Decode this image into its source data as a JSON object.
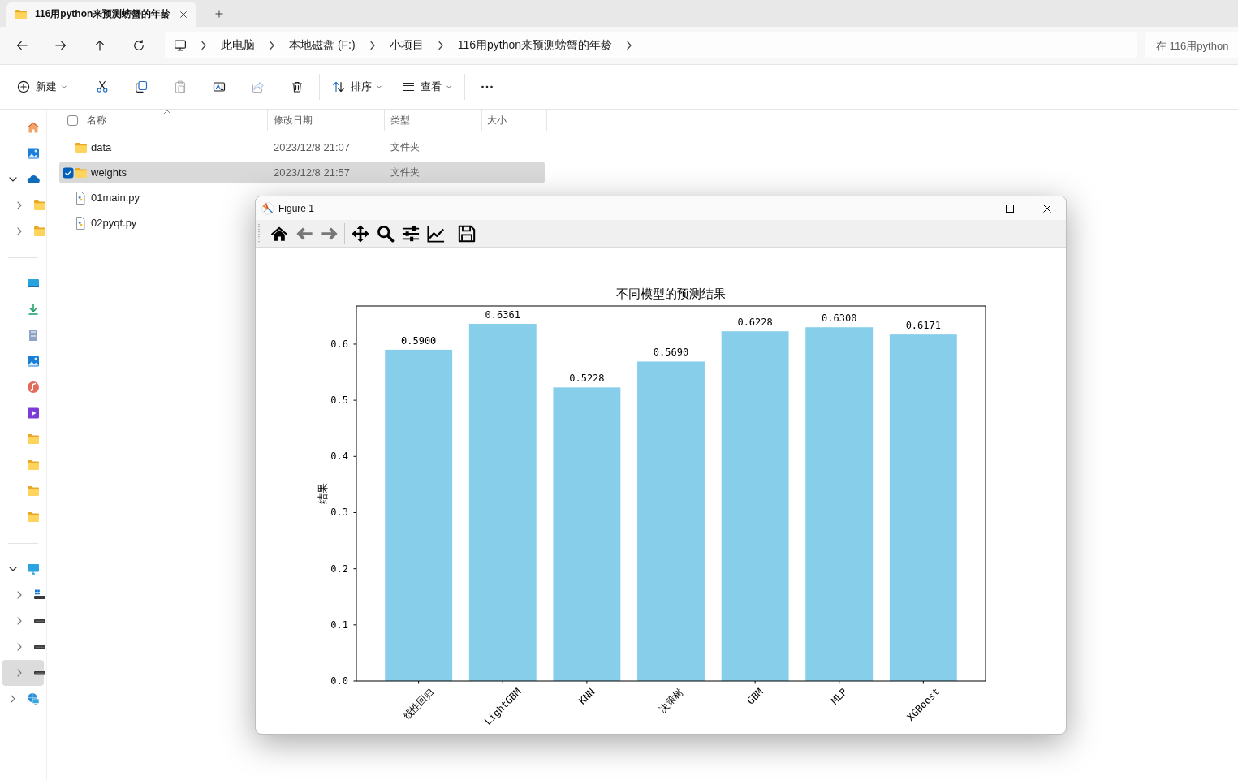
{
  "tabs": [
    {
      "title": "116用python来预测螃蟹的年龄",
      "selected": true
    }
  ],
  "nav_buttons": [
    {
      "kind": "back",
      "disabled": false
    },
    {
      "kind": "forward",
      "disabled": false
    },
    {
      "kind": "up",
      "disabled": false
    },
    {
      "kind": "refresh",
      "disabled": false
    }
  ],
  "address_bar": {
    "segments": [
      "此电脑",
      "本地磁盘 (F:)",
      "小项目",
      "116用python来预测螃蟹的年龄"
    ]
  },
  "search": {
    "placeholder": "在 116用python"
  },
  "toolbar": {
    "groups": [
      [
        {
          "kind": "new",
          "label": "新建",
          "menu": true,
          "disabled": false
        }
      ],
      [
        {
          "kind": "cut",
          "menu": false,
          "disabled": false
        },
        {
          "kind": "copy",
          "menu": false,
          "disabled": false
        },
        {
          "kind": "paste",
          "menu": false,
          "disabled": true
        },
        {
          "kind": "rename",
          "menu": false,
          "disabled": false
        },
        {
          "kind": "share",
          "menu": false,
          "disabled": true
        },
        {
          "kind": "delete",
          "menu": false,
          "disabled": false
        }
      ],
      [
        {
          "kind": "sort",
          "label": "排序",
          "menu": true,
          "disabled": false
        },
        {
          "kind": "view",
          "label": "查看",
          "menu": true,
          "disabled": false
        }
      ],
      [
        {
          "kind": "more",
          "menu": false,
          "disabled": false
        }
      ]
    ]
  },
  "nav_pane": {
    "sections": [
      {
        "items": [
          {
            "kind": "home",
            "selected": false
          },
          {
            "kind": "gallery",
            "selected": false
          },
          {
            "kind": "cloud",
            "expanded": true,
            "selected": false,
            "children": [
              {
                "kind": "folder",
                "expanded": false,
                "selected": false
              },
              {
                "kind": "folder",
                "expanded": false,
                "selected": false
              }
            ]
          }
        ]
      },
      {
        "items": [
          {
            "kind": "desktop",
            "selected": false
          },
          {
            "kind": "downloads",
            "selected": false
          },
          {
            "kind": "documents",
            "selected": false
          },
          {
            "kind": "pictures",
            "selected": false
          },
          {
            "kind": "music",
            "selected": false
          },
          {
            "kind": "videos",
            "selected": false
          },
          {
            "kind": "folder",
            "selected": false
          },
          {
            "kind": "folder",
            "selected": false
          },
          {
            "kind": "folder",
            "selected": false
          },
          {
            "kind": "folder",
            "selected": false
          }
        ]
      },
      {
        "items": [
          {
            "kind": "pc",
            "expanded": true,
            "selected": false,
            "children": [
              {
                "kind": "system-drive",
                "expanded": false,
                "selected": false
              },
              {
                "kind": "drive",
                "expanded": false,
                "selected": false
              },
              {
                "kind": "drive",
                "expanded": false,
                "selected": false
              },
              {
                "kind": "drive",
                "expanded": false,
                "selected": true
              }
            ]
          },
          {
            "kind": "network",
            "expanded": false,
            "selected": false
          }
        ]
      }
    ]
  },
  "file_list": {
    "select_all": {
      "checked": false
    },
    "columns": [
      {
        "label": "名称",
        "sorted": true
      },
      {
        "label": "修改日期",
        "sorted": false
      },
      {
        "label": "类型",
        "sorted": false
      },
      {
        "label": "大小",
        "sorted": false
      }
    ],
    "rows": [
      {
        "kind": "folder",
        "name": "data",
        "date": "2023/12/8 21:07",
        "type": "文件夹",
        "selected": false
      },
      {
        "kind": "folder",
        "name": "weights",
        "date": "2023/12/8 21:57",
        "type": "文件夹",
        "selected": true
      },
      {
        "kind": "python",
        "name": "01main.py",
        "selected": false
      },
      {
        "kind": "python",
        "name": "02pyqt.py",
        "selected": false
      }
    ]
  },
  "figure_window": {
    "title": "Figure 1",
    "toolbar": {
      "groups": [
        [
          {
            "kind": "home",
            "disabled": false
          },
          {
            "kind": "back",
            "disabled": true
          },
          {
            "kind": "forward",
            "disabled": true
          }
        ],
        [
          {
            "kind": "pan",
            "disabled": false
          },
          {
            "kind": "zoom",
            "disabled": false
          },
          {
            "kind": "subplots",
            "disabled": false
          },
          {
            "kind": "edit",
            "disabled": false
          }
        ],
        [
          {
            "kind": "save",
            "disabled": false
          }
        ]
      ]
    },
    "chart_data": {
      "type": "bar",
      "title": "不同模型的预测结果",
      "ylabel": "结果",
      "categories": [
        "线性回归",
        "LightGBM",
        "KNN",
        "决策树",
        "GBM",
        "MLP",
        "XGBoost"
      ],
      "values": [
        0.59,
        0.6361,
        0.5228,
        0.569,
        0.6228,
        0.63,
        0.6171
      ],
      "value_labels": [
        "0.5900",
        "0.6361",
        "0.5228",
        "0.5690",
        "0.6228",
        "0.6300",
        "0.6171"
      ],
      "ylim": [
        0,
        0.6679
      ],
      "yticks": [
        {
          "value": 0,
          "label": "0.0"
        },
        {
          "value": 0.1,
          "label": "0.1"
        },
        {
          "value": 0.2,
          "label": "0.2"
        },
        {
          "value": 0.3,
          "label": "0.3"
        },
        {
          "value": 0.4,
          "label": "0.4"
        },
        {
          "value": 0.5,
          "label": "0.5"
        },
        {
          "value": 0.6,
          "label": "0.6"
        }
      ]
    }
  }
}
